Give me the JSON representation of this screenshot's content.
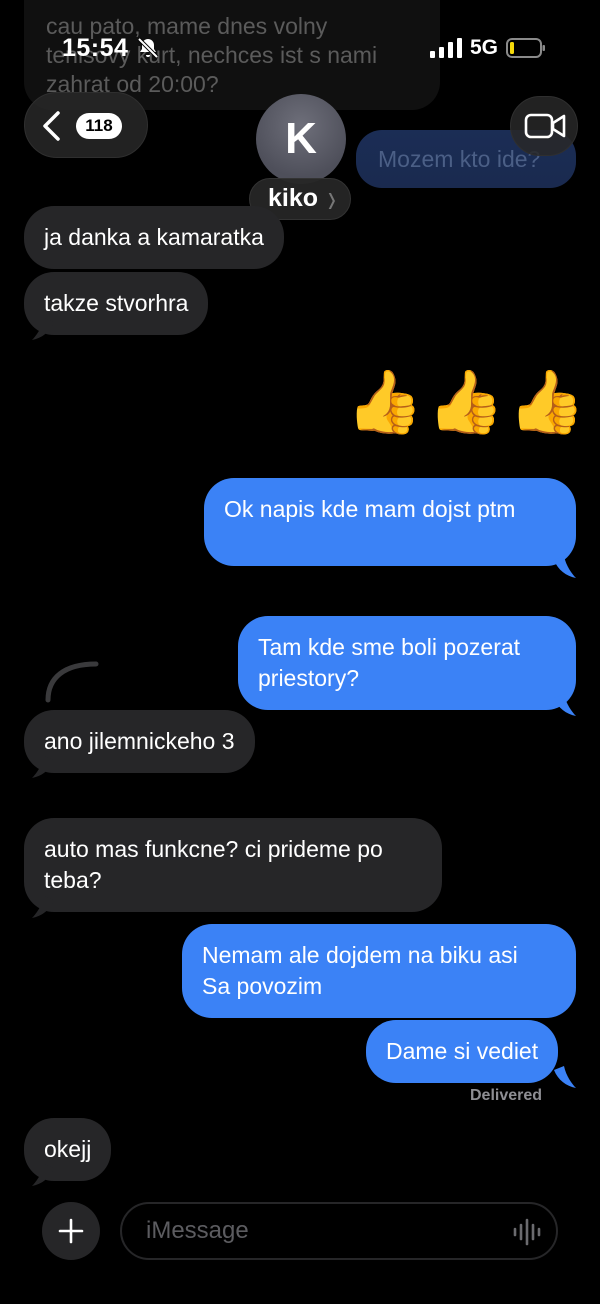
{
  "status": {
    "time": "15:54",
    "network": "5G"
  },
  "header": {
    "back_count": "118",
    "contact_initial": "K",
    "contact_name": "kiko"
  },
  "background_messages": {
    "incoming_faded": "cau pato, mame dnes volny\ntenisovy kurt, nechces ist s nami\nzahrat od 20:00?",
    "outgoing_faded": "Mozem kto ide?"
  },
  "messages": [
    {
      "dir": "in",
      "text": "ja danka a kamaratka"
    },
    {
      "dir": "in",
      "text": "takze stvorhra"
    },
    {
      "dir": "out",
      "text": "👍👍👍"
    },
    {
      "dir": "out",
      "text": "Ok napis kde mam dojst ptm"
    },
    {
      "dir": "out",
      "text": "Tam kde sme boli pozerat\npriestory?"
    },
    {
      "dir": "in",
      "text": "ano jilemnickeho 3"
    },
    {
      "dir": "in",
      "text": "auto mas funkcne? ci prideme po\nteba?"
    },
    {
      "dir": "out",
      "text": "Nemam ale dojdem na biku asi\nSa povozim"
    },
    {
      "dir": "out",
      "text": "Dame si vediet"
    },
    {
      "dir": "in",
      "text": "okejj"
    }
  ],
  "delivered_label": "Delivered",
  "composer": {
    "placeholder": "iMessage"
  },
  "colors": {
    "incoming": "#262628",
    "outgoing": "#3b82f6",
    "background": "#000000"
  },
  "icons": [
    "back-chevron-icon",
    "bell-slash-icon",
    "signal-icon",
    "battery-icon",
    "video-camera-icon",
    "plus-icon",
    "voice-waveform-icon"
  ]
}
